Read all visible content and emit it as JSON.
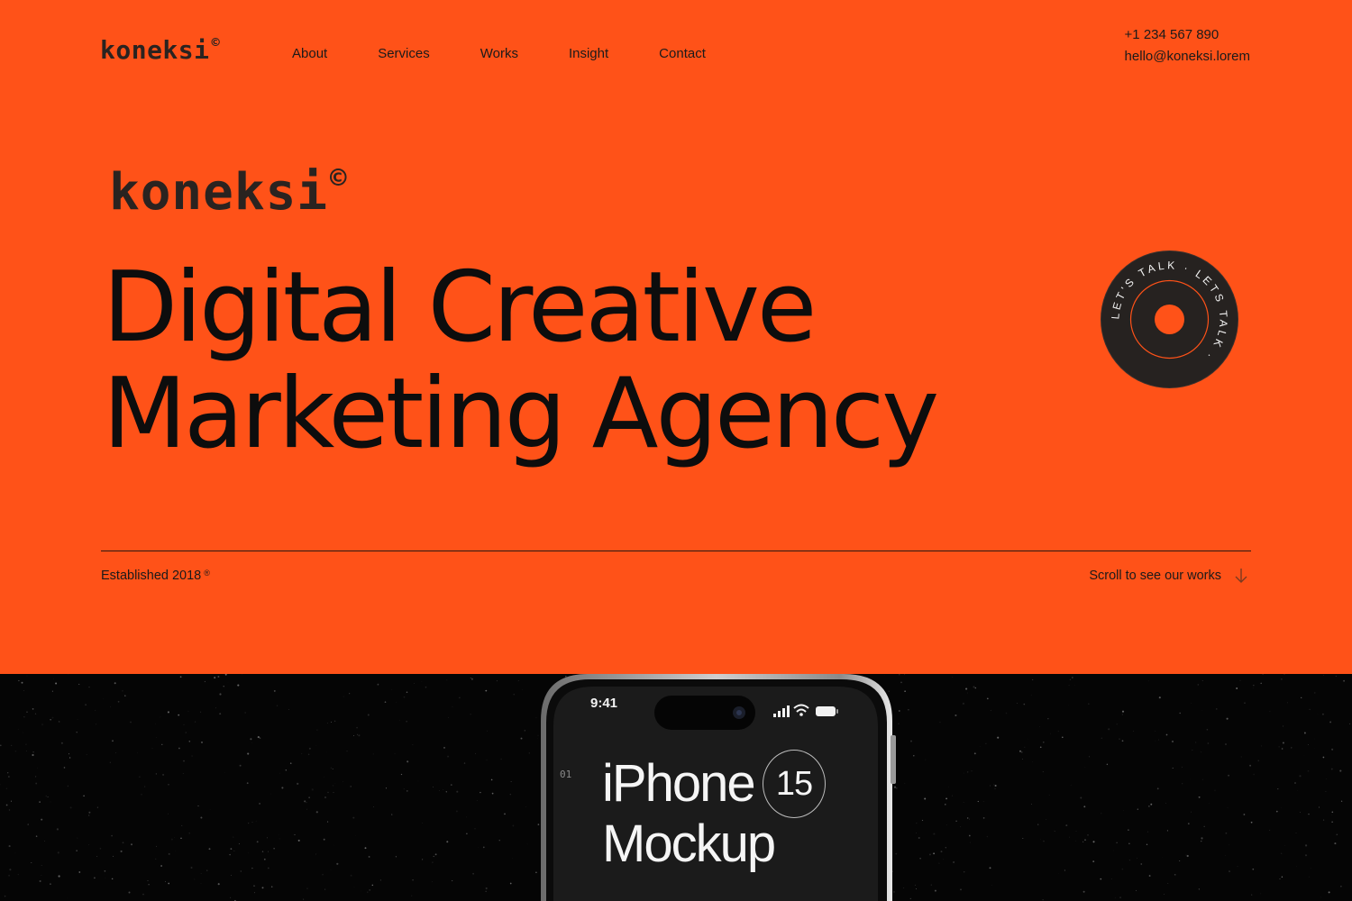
{
  "brand": {
    "name": "koneksi",
    "mark": "©"
  },
  "nav": {
    "items": [
      "About",
      "Services",
      "Works",
      "Insight",
      "Contact"
    ]
  },
  "contact": {
    "phone": "+1 234 567 890",
    "email": "hello@koneksi.lorem"
  },
  "hero": {
    "logo_name": "koneksi",
    "logo_mark": "©",
    "headline_line1": "Digital Creative",
    "headline_line2": "Marketing Agency",
    "badge_text": "LET'S TALK · LETS TALK ·",
    "established": "Established 2018",
    "established_mark": "®",
    "scroll_label": "Scroll to see our works"
  },
  "showcase": {
    "phone_time": "9:41",
    "index": "01",
    "title_line1": "iPhone",
    "badge_number": "15",
    "title_line2": "Mockup"
  },
  "colors": {
    "accent": "#FF5218",
    "dark": "#0d0d0d",
    "badge_bg": "#262220"
  }
}
